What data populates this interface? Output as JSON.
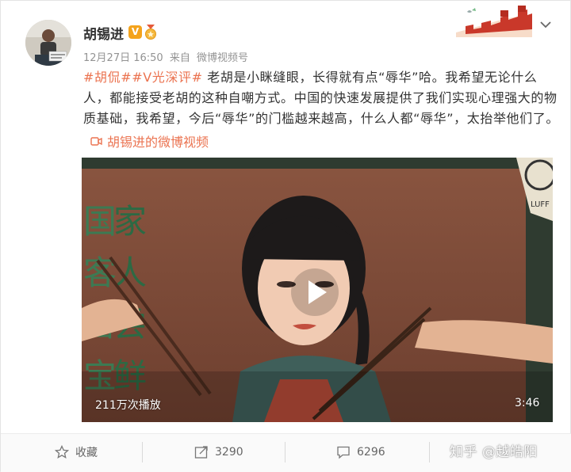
{
  "post": {
    "author": "胡锡进",
    "verified_badge": "V",
    "timestamp": "12月27日 16:50",
    "source_prefix": "来自",
    "source": "微博视频号",
    "topic_1": "#胡侃#",
    "topic_2": "#V光深评#",
    "body": "老胡是小眯缝眼，长得就有点“辱华”哈。我希望无论什么人，都能接受老胡的这种自嘲方式。中国的快速发展提供了我们实现心理强大的物质基础，我希望，今后“辱华”的门槛越来越高，什么人都“辱华”，太抬举他们了。",
    "video_link": "胡锡进的微博视频"
  },
  "video": {
    "play_count": "211万次播放",
    "duration": "3:46",
    "sign_chars_right": [
      "家",
      "人",
      "尝",
      "鲜"
    ],
    "sign_chars_left": [
      "国",
      "客",
      "苦",
      "宝"
    ],
    "corner_label": "LUFF"
  },
  "actions": {
    "favorite_label": "收藏",
    "repost_count": "3290",
    "comment_count": "6296"
  },
  "watermark": "知乎 @越皓阳",
  "colors": {
    "accent": "#eb7350",
    "text": "#333333",
    "meta": "#939393"
  },
  "icons": [
    "chevron-down-icon",
    "verified-v-icon",
    "medal-icon",
    "great-wall-icon",
    "video-camera-icon",
    "play-icon",
    "star-icon",
    "repost-icon",
    "comment-icon"
  ]
}
